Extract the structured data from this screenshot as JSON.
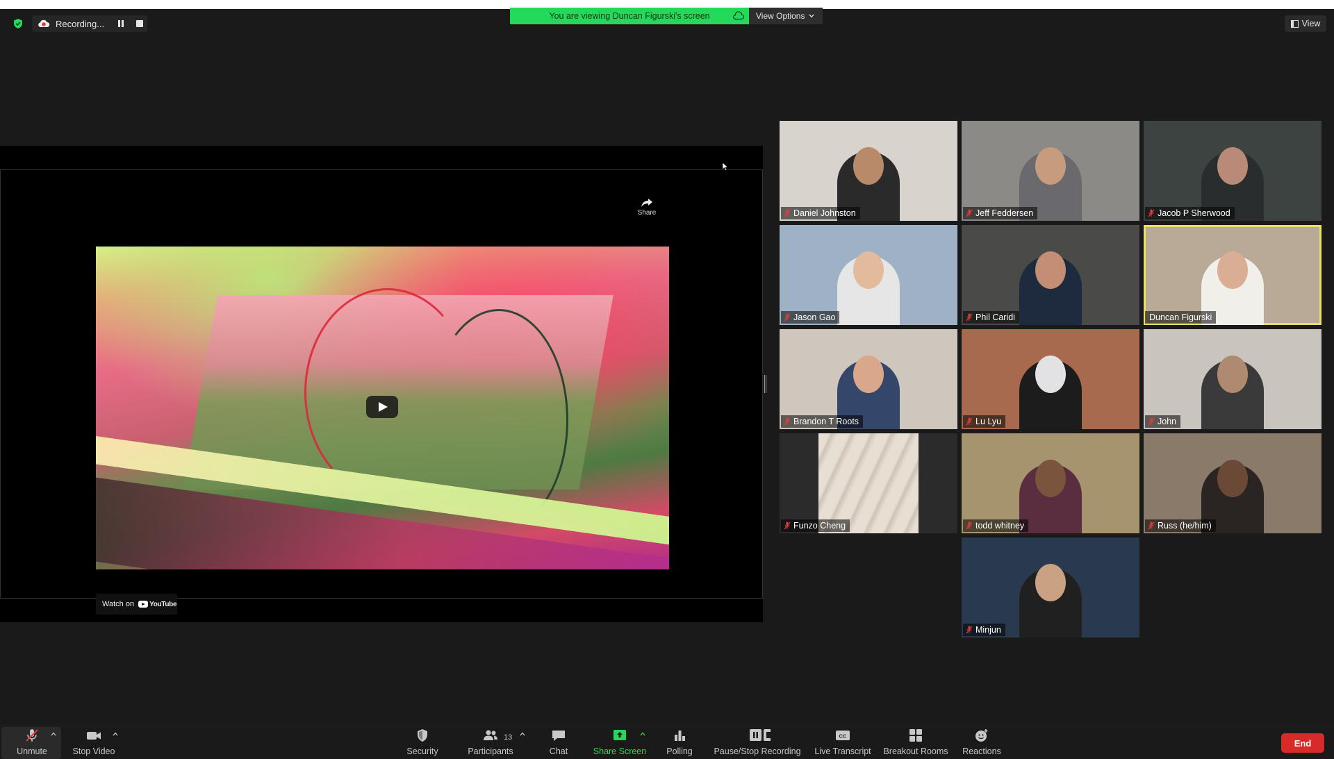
{
  "recording": {
    "label": "Recording..."
  },
  "banner": {
    "text": "You are viewing Duncan Figurski's screen",
    "view_options": "View Options"
  },
  "view_button": {
    "label": "View"
  },
  "shared_video": {
    "share_label": "Share",
    "watch_on_label": "Watch on",
    "youtube_label": "YouTube"
  },
  "participants": [
    {
      "name": "Daniel Johnston",
      "muted": true,
      "bg": "#d8d3cc",
      "body": "#2a2a2a",
      "skin": "#b98a6a"
    },
    {
      "name": "Jeff Feddersen",
      "muted": true,
      "bg": "#8c8a86",
      "body": "#6a6a6e",
      "skin": "#c79b7e"
    },
    {
      "name": "Jacob P Sherwood",
      "muted": true,
      "bg": "#3d4340",
      "body": "#2a2d2e",
      "skin": "#b98a78"
    },
    {
      "name": "Jason Gao",
      "muted": true,
      "bg": "#9fb1c4",
      "body": "#e6e6e6",
      "skin": "#e1bb9c"
    },
    {
      "name": "Phil Caridi",
      "muted": true,
      "bg": "#4a4a48",
      "body": "#1e2a3e",
      "skin": "#c48e75"
    },
    {
      "name": "Duncan Figurski",
      "muted": false,
      "active": true,
      "bg": "#b9aa98",
      "body": "#f1efea",
      "skin": "#d9ae94"
    },
    {
      "name": "Brandon T Roots",
      "muted": true,
      "bg": "#cfc7bd",
      "body": "#34466a",
      "skin": "#d9a88b"
    },
    {
      "name": "Lu Lyu",
      "muted": true,
      "bg": "#a86a4e",
      "body": "#1c1c1c",
      "skin": "#e2e2e4"
    },
    {
      "name": "John",
      "muted": true,
      "bg": "#c9c4bd",
      "body": "#3a3a3a",
      "skin": "#b08a70"
    },
    {
      "name": "Funzo Cheng",
      "muted": true,
      "sand": true
    },
    {
      "name": "todd whitney",
      "muted": true,
      "bg": "#a5946e",
      "body": "#5a2e3e",
      "skin": "#7a543c"
    },
    {
      "name": "Russ (he/him)",
      "muted": true,
      "bg": "#8a7a6a",
      "body": "#2a2522",
      "skin": "#6a4a36"
    },
    {
      "name": "Minjun",
      "muted": true,
      "bg": "#2a3a4e",
      "body": "#202020",
      "skin": "#c9a284"
    }
  ],
  "toolbar": {
    "unmute": "Unmute",
    "stop_video": "Stop Video",
    "security": "Security",
    "participants": "Participants",
    "participants_count": "13",
    "chat": "Chat",
    "share_screen": "Share Screen",
    "polling": "Polling",
    "pause_stop_recording": "Pause/Stop Recording",
    "live_transcript": "Live Transcript",
    "breakout_rooms": "Breakout Rooms",
    "reactions": "Reactions",
    "end": "End"
  }
}
